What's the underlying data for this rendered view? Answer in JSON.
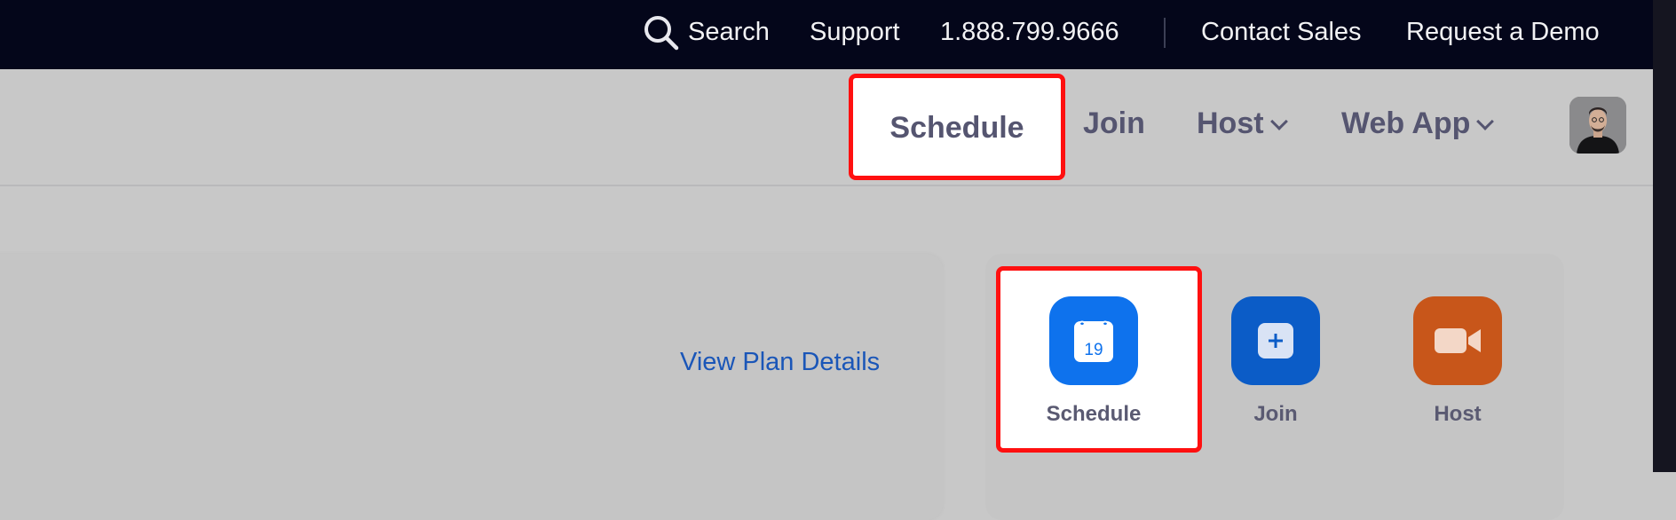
{
  "topbar": {
    "search_label": "Search",
    "support_label": "Support",
    "phone": "1.888.799.9666",
    "contact_sales_label": "Contact Sales",
    "request_demo_label": "Request a Demo"
  },
  "nav": {
    "schedule_label": "Schedule",
    "join_label": "Join",
    "host_label": "Host",
    "web_app_label": "Web App"
  },
  "main": {
    "view_plan_details_label": "View Plan Details"
  },
  "actions": {
    "schedule": {
      "label": "Schedule",
      "calendar_day": "19",
      "color": "#0e72ed"
    },
    "join": {
      "label": "Join",
      "color": "#0b5cc7"
    },
    "host": {
      "label": "Host",
      "color": "#c8561a"
    }
  },
  "colors": {
    "topbar_bg": "#04061a",
    "highlight_border": "#ff1010",
    "link": "#1a56b8"
  }
}
